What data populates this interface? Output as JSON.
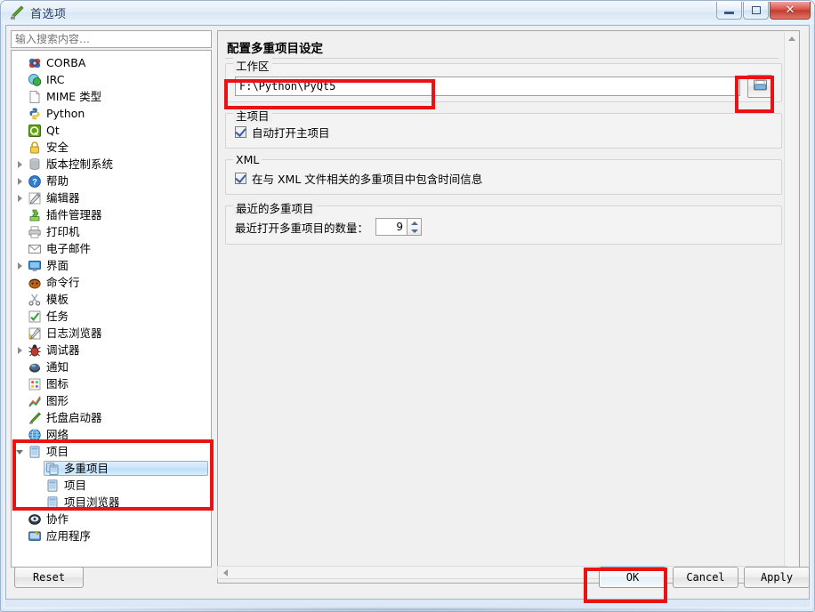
{
  "window": {
    "title": "首选项",
    "app_icon": "pencil-icon",
    "caption_buttons": [
      {
        "name": "minimize",
        "glyph": "—"
      },
      {
        "name": "restore",
        "glyph": "❐"
      },
      {
        "name": "close",
        "glyph": "✕"
      }
    ]
  },
  "sidebar": {
    "search": {
      "placeholder": "输入搜索内容…",
      "value": ""
    },
    "items": [
      {
        "label": "CORBA",
        "icon": "corba-icon",
        "indent": 0,
        "expander": "none",
        "selected": false
      },
      {
        "label": "IRC",
        "icon": "irc-icon",
        "indent": 0,
        "expander": "none",
        "selected": false
      },
      {
        "label": "MIME 类型",
        "icon": "mime-icon",
        "indent": 0,
        "expander": "none",
        "selected": false
      },
      {
        "label": "Python",
        "icon": "python-icon",
        "indent": 0,
        "expander": "none",
        "selected": false
      },
      {
        "label": "Qt",
        "icon": "qt-icon",
        "indent": 0,
        "expander": "none",
        "selected": false
      },
      {
        "label": "安全",
        "icon": "lock-icon",
        "indent": 0,
        "expander": "none",
        "selected": false
      },
      {
        "label": "版本控制系统",
        "icon": "vcs-icon",
        "indent": 0,
        "expander": "closed",
        "selected": false
      },
      {
        "label": "帮助",
        "icon": "help-icon",
        "indent": 0,
        "expander": "closed",
        "selected": false
      },
      {
        "label": "编辑器",
        "icon": "editor-icon",
        "indent": 0,
        "expander": "closed",
        "selected": false
      },
      {
        "label": "插件管理器",
        "icon": "plugin-icon",
        "indent": 0,
        "expander": "none",
        "selected": false
      },
      {
        "label": "打印机",
        "icon": "printer-icon",
        "indent": 0,
        "expander": "none",
        "selected": false
      },
      {
        "label": "电子邮件",
        "icon": "mail-icon",
        "indent": 0,
        "expander": "none",
        "selected": false
      },
      {
        "label": "界面",
        "icon": "monitor-icon",
        "indent": 0,
        "expander": "closed",
        "selected": false
      },
      {
        "label": "命令行",
        "icon": "shell-icon",
        "indent": 0,
        "expander": "none",
        "selected": false
      },
      {
        "label": "模板",
        "icon": "scissors-icon",
        "indent": 0,
        "expander": "none",
        "selected": false
      },
      {
        "label": "任务",
        "icon": "task-check-icon",
        "indent": 0,
        "expander": "none",
        "selected": false
      },
      {
        "label": "日志浏览器",
        "icon": "logviewer-icon",
        "indent": 0,
        "expander": "none",
        "selected": false
      },
      {
        "label": "调试器",
        "icon": "bug-icon",
        "indent": 0,
        "expander": "closed",
        "selected": false
      },
      {
        "label": "通知",
        "icon": "notification-icon",
        "indent": 0,
        "expander": "none",
        "selected": false
      },
      {
        "label": "图标",
        "icon": "icons-icon",
        "indent": 0,
        "expander": "none",
        "selected": false
      },
      {
        "label": "图形",
        "icon": "graph-icon",
        "indent": 0,
        "expander": "none",
        "selected": false
      },
      {
        "label": "托盘启动器",
        "icon": "tray-icon",
        "indent": 0,
        "expander": "none",
        "selected": false
      },
      {
        "label": "网络",
        "icon": "globe-icon",
        "indent": 0,
        "expander": "none",
        "selected": false
      },
      {
        "label": "项目",
        "icon": "project-icon",
        "indent": 0,
        "expander": "open",
        "selected": false
      },
      {
        "label": "多重项目",
        "icon": "multiproject-icon",
        "indent": 1,
        "expander": "none",
        "selected": true
      },
      {
        "label": "项目",
        "icon": "project-icon",
        "indent": 1,
        "expander": "none",
        "selected": false
      },
      {
        "label": "项目浏览器",
        "icon": "project-icon",
        "indent": 1,
        "expander": "none",
        "selected": false
      },
      {
        "label": "协作",
        "icon": "collab-icon",
        "indent": 0,
        "expander": "none",
        "selected": false
      },
      {
        "label": "应用程序",
        "icon": "application-icon",
        "indent": 0,
        "expander": "none",
        "selected": false
      }
    ]
  },
  "main": {
    "title": "配置多重项目设定",
    "workspace": {
      "group_label": "工作区",
      "path_value": "F:\\Python\\PyQt5",
      "path_placeholder": "",
      "dir_button_icon": "open-folder-icon"
    },
    "main_project": {
      "group_label": "主项目",
      "checkbox_label": "自动打开主项目",
      "checked": true
    },
    "xml": {
      "group_label": "XML",
      "checkbox_label": "在与 XML 文件相关的多重项目中包含时间信息",
      "checked": true
    },
    "recent": {
      "group_label": "最近的多重项目",
      "field_label": "最近打开多重项目的数量：",
      "value": "9"
    }
  },
  "footer": {
    "reset_label": "Reset",
    "ok_label": "OK",
    "cancel_label": "Cancel",
    "apply_label": "Apply"
  },
  "colors": {
    "annotation_red": "#e81313",
    "selection_blue": "#bcddf9",
    "focus_border": "#5ba8d8"
  }
}
